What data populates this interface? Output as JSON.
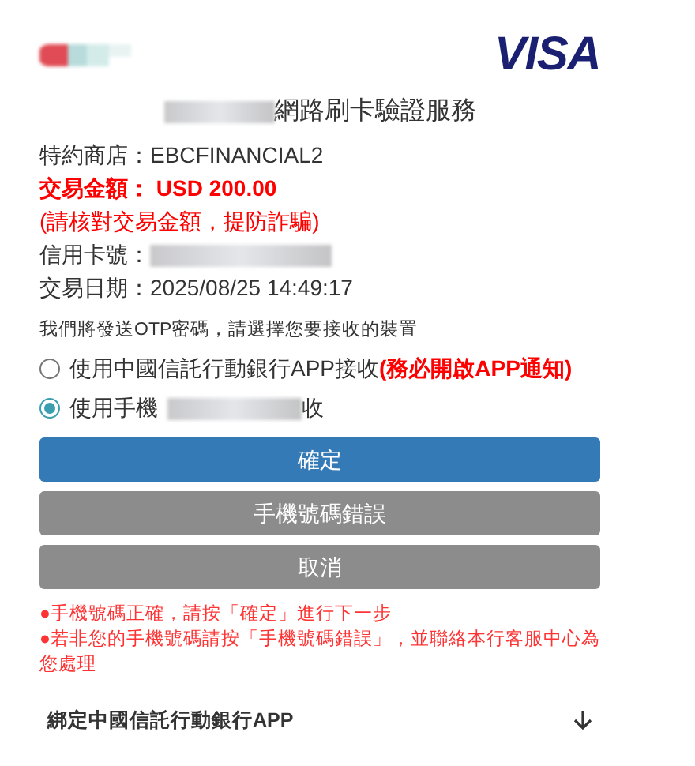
{
  "header": {
    "brand": "VISA"
  },
  "title": "網路刷卡驗證服務",
  "details": [
    {
      "kind": "plain",
      "label": "特約商店：",
      "value": "EBCFINANCIAL2"
    },
    {
      "kind": "alert",
      "label": "交易金額：",
      "value": "USD 200.00"
    },
    {
      "kind": "warning",
      "text": "(請核對交易金額，提防詐騙)"
    },
    {
      "kind": "redacted",
      "label": "信用卡號："
    },
    {
      "kind": "plain",
      "label": "交易日期：",
      "value": "2025/08/25 14:49:17"
    }
  ],
  "otp_prompt": "我們將發送OTP密碼，請選擇您要接收的裝置",
  "options": [
    {
      "label": "使用中國信託行動銀行APP接收",
      "note": "(務必開啟APP通知)",
      "selected": false
    },
    {
      "label": "使用手機",
      "label_end": "收",
      "redacted": true,
      "selected": true
    }
  ],
  "buttons": [
    {
      "kind": "primary",
      "label": "確定"
    },
    {
      "kind": "secondary",
      "label": "手機號碼錯誤"
    },
    {
      "kind": "secondary",
      "label": "取消"
    }
  ],
  "notes": [
    "●手機號碼正確，請按「確定」進行下一步",
    "●若非您的手機號碼請按「手機號碼錯誤」，並聯絡本行客服中心為您處理"
  ],
  "accordion": {
    "label": "綁定中國信託行動銀行APP",
    "expanded": false
  }
}
